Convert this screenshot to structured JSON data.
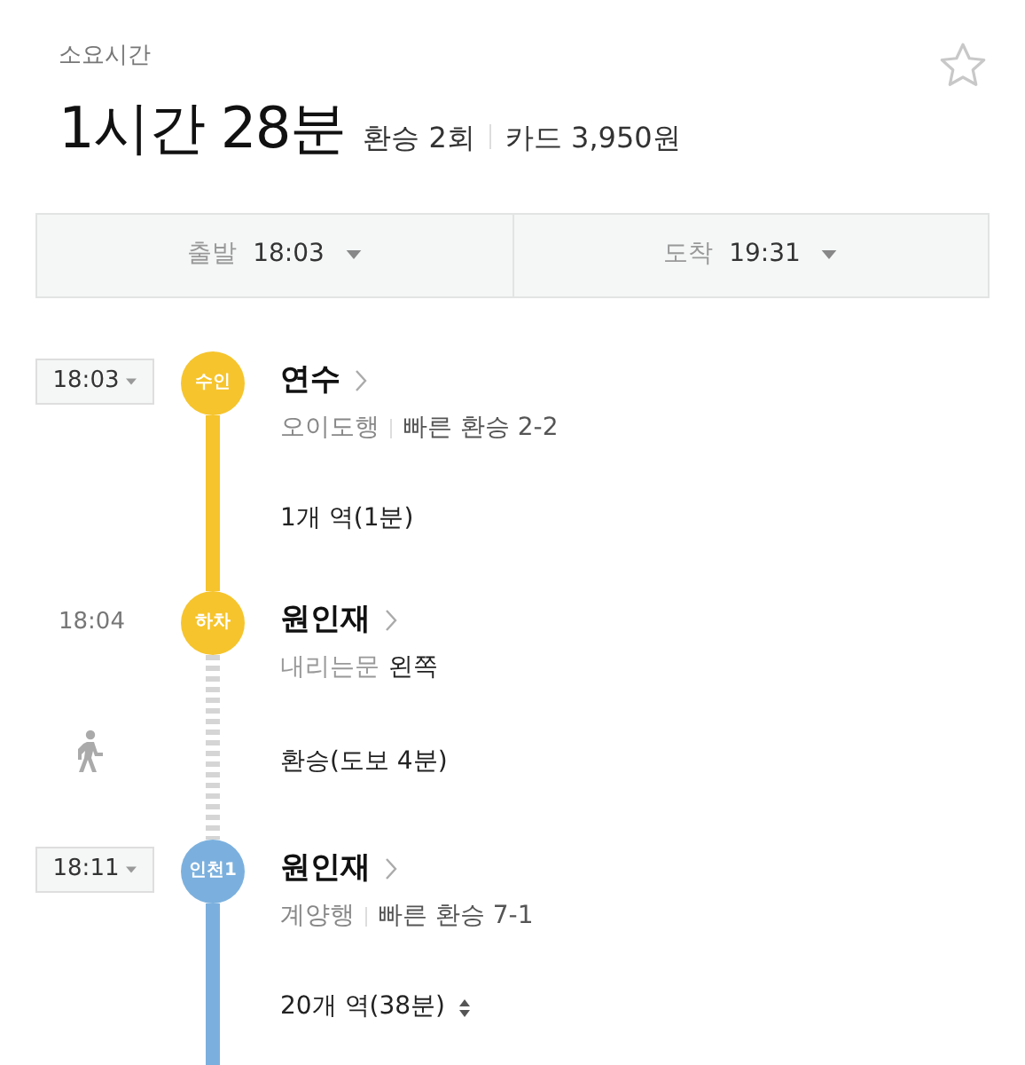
{
  "summary": {
    "label": "소요시간",
    "duration": "1시간 28분",
    "transfers": "환승 2회",
    "fare": "카드 3,950원",
    "favorite": false
  },
  "time_bar": [
    {
      "label": "출발",
      "time": "18:03"
    },
    {
      "label": "도착",
      "time": "19:31"
    }
  ],
  "steps": [
    {
      "kind": "board",
      "time": "18:03",
      "badge": "수인",
      "color": "#f6c42c",
      "station": "연수",
      "direction": "오이도행",
      "fast_transfer": "빠른 환승 2-2",
      "ride": "1개 역(1분)",
      "expandable": false
    },
    {
      "kind": "alight",
      "time": "18:04",
      "badge": "하차",
      "color": "#f6c42c",
      "station": "원인재",
      "door_label": "내리는문",
      "door_side": "왼쪽",
      "walk": "환승(도보 4분)"
    },
    {
      "kind": "board",
      "time": "18:11",
      "badge": "인천1",
      "color": "#7bb0de",
      "station": "원인재",
      "direction": "계양행",
      "fast_transfer": "빠른 환승 7-1",
      "ride": "20개 역(38분)",
      "expandable": true
    }
  ]
}
